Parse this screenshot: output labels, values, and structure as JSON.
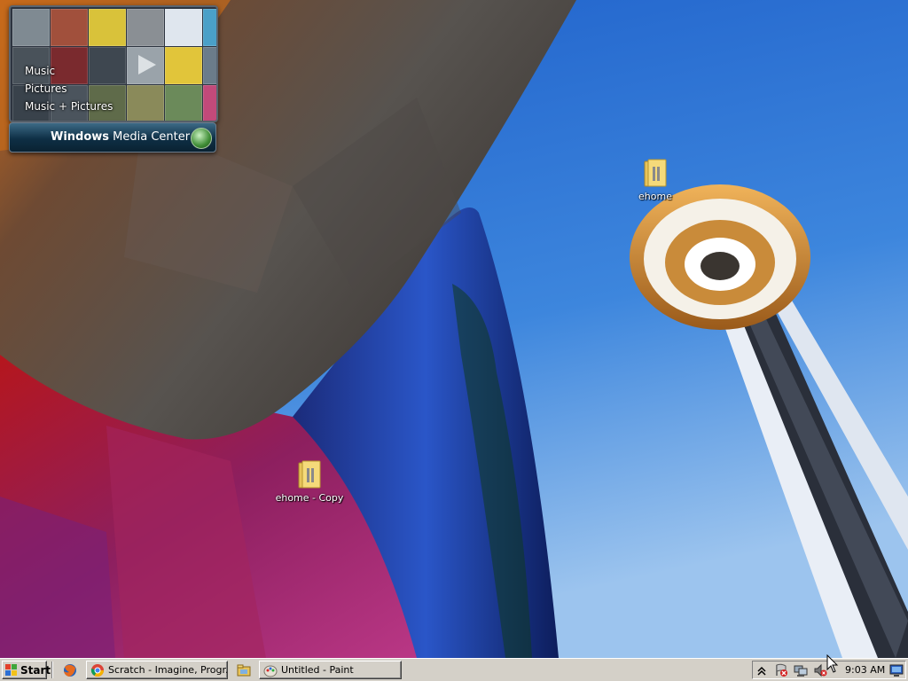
{
  "gadget": {
    "menu": [
      "Music",
      "Pictures",
      "Music + Pictures"
    ],
    "title_bold": "Windows",
    "title_rest": " Media Center"
  },
  "desktop_icons": [
    {
      "label": "ehome",
      "icon": "folder-icon"
    },
    {
      "label": "ehome - Copy",
      "icon": "folder-icon"
    }
  ],
  "taskbar": {
    "start_label": "Start",
    "quick_launch": [
      "firefox-icon",
      "explorer-icon"
    ],
    "tasks": [
      {
        "label": "Scratch - Imagine, Progr...",
        "icon": "chrome-icon"
      },
      {
        "label": "Untitled - Paint",
        "icon": "paint-icon"
      }
    ],
    "tray_icons": [
      "show-hidden-icons-chevron",
      "security-alert-icon",
      "network-icon",
      "volume-muted-icon",
      "display-icon"
    ],
    "clock": "9:03 AM"
  },
  "colors": {
    "sky": "#2f6fd0",
    "taskbar": "#d4d0c8"
  }
}
